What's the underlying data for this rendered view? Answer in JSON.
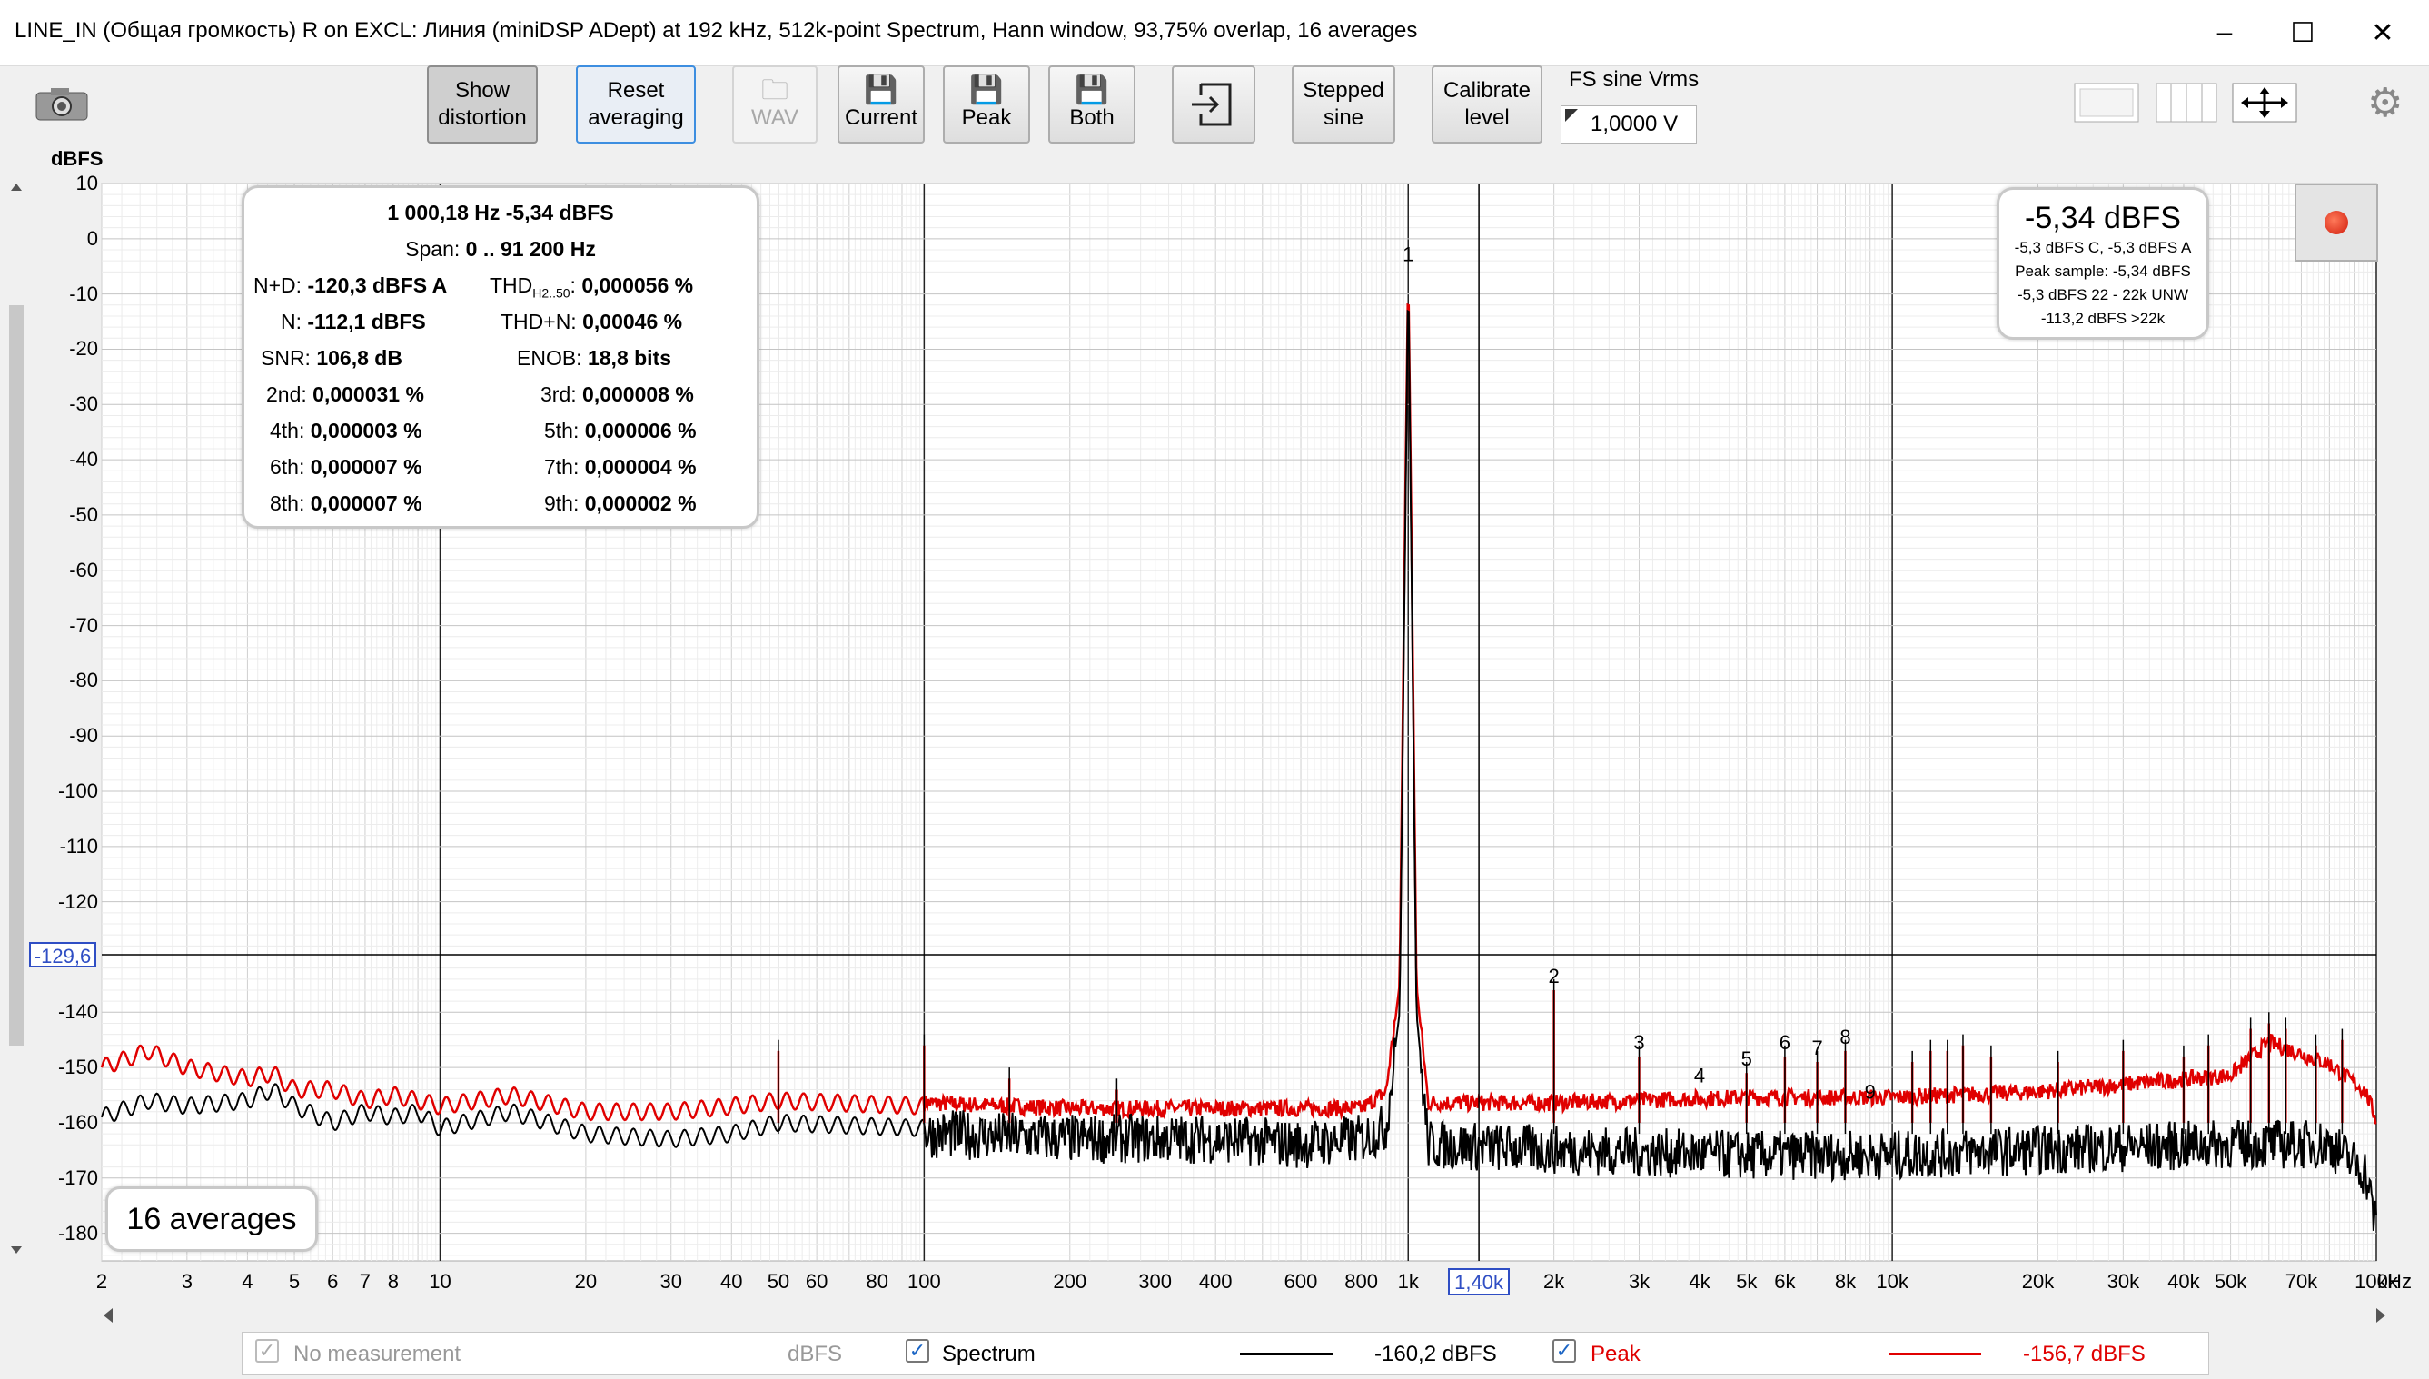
{
  "window": {
    "title": "LINE_IN (Общая громкость) R on EXCL: Линия (miniDSP ADept) at 192 kHz, 512k-point Spectrum, Hann window, 93,75% overlap, 16 averages",
    "minimize": "–",
    "maximize": "☐",
    "close": "✕"
  },
  "toolbar": {
    "show_distortion": [
      "Show",
      "distortion"
    ],
    "reset_averaging": [
      "Reset",
      "averaging"
    ],
    "wav": "WAV",
    "current": "Current",
    "peak": "Peak",
    "both": "Both",
    "stepped_sine": [
      "Stepped",
      "sine"
    ],
    "calibrate_level": [
      "Calibrate",
      "level"
    ],
    "fs_label": "FS sine Vrms",
    "fs_value": "1,0000 V"
  },
  "plot": {
    "y_unit": "dBFS",
    "cursor_y": "-129,6",
    "cursor_x": "1,40k",
    "x_unit": "kHz"
  },
  "measurement": {
    "header": "1 000,18 Hz  -5,34 dBFS",
    "span_label": "Span:",
    "span_value": "0 .. 91 200 Hz",
    "nd_label": "N+D:",
    "nd_value": "-120,3 dBFS A",
    "thd_label": "THD",
    "thd_sub": "H2..50",
    "thd_colon": ":",
    "thd_value": "0,000056 %",
    "n_label": "N:",
    "n_value": "-112,1 dBFS",
    "thdn_label": "THD+N:",
    "thdn_value": "0,00046 %",
    "snr_label": "SNR:",
    "snr_value": "106,8 dB",
    "enob_label": "ENOB:",
    "enob_value": "18,8 bits",
    "h2_label": "2nd:",
    "h2_value": "0,000031 %",
    "h3_label": "3rd:",
    "h3_value": "0,000008 %",
    "h4_label": "4th:",
    "h4_value": "0,000003 %",
    "h5_label": "5th:",
    "h5_value": "0,000006 %",
    "h6_label": "6th:",
    "h6_value": "0,000007 %",
    "h7_label": "7th:",
    "h7_value": "0,000004 %",
    "h8_label": "8th:",
    "h8_value": "0,000007 %",
    "h9_label": "9th:",
    "h9_value": "0,000002 %"
  },
  "level_box": {
    "main": "-5,34 dBFS",
    "line1": "-5,3 dBFS C, -5,3 dBFS A",
    "line2": "Peak sample: -5,34 dBFS",
    "line3": "-5,3 dBFS 22 - 22k UNW",
    "line4": "-113,2 dBFS >22k"
  },
  "averages_label": "16 averages",
  "legend": {
    "no_measurement": "No measurement",
    "no_measurement_unit": "dBFS",
    "spectrum": "Spectrum",
    "spectrum_value": "-160,2 dBFS",
    "peak": "Peak",
    "peak_value": "-156,7 dBFS",
    "spectrum_color": "#000000",
    "peak_color": "#e00000"
  },
  "chart_data": {
    "type": "line",
    "xscale": "log",
    "xlim": [
      2,
      100000
    ],
    "ylim": [
      -185,
      10
    ],
    "xticks": [
      {
        "v": 2,
        "label": "2"
      },
      {
        "v": 3,
        "label": "3"
      },
      {
        "v": 4,
        "label": "4"
      },
      {
        "v": 5,
        "label": "5"
      },
      {
        "v": 6,
        "label": "6"
      },
      {
        "v": 7,
        "label": "7"
      },
      {
        "v": 8,
        "label": "8"
      },
      {
        "v": 10,
        "label": "10"
      },
      {
        "v": 20,
        "label": "20"
      },
      {
        "v": 30,
        "label": "30"
      },
      {
        "v": 40,
        "label": "40"
      },
      {
        "v": 50,
        "label": "50"
      },
      {
        "v": 60,
        "label": "60"
      },
      {
        "v": 80,
        "label": "80"
      },
      {
        "v": 100,
        "label": "100"
      },
      {
        "v": 200,
        "label": "200"
      },
      {
        "v": 300,
        "label": "300"
      },
      {
        "v": 400,
        "label": "400"
      },
      {
        "v": 600,
        "label": "600"
      },
      {
        "v": 800,
        "label": "800"
      },
      {
        "v": 1000,
        "label": "1k"
      },
      {
        "v": 2000,
        "label": "2k"
      },
      {
        "v": 3000,
        "label": "3k"
      },
      {
        "v": 4000,
        "label": "4k"
      },
      {
        "v": 5000,
        "label": "5k"
      },
      {
        "v": 6000,
        "label": "6k"
      },
      {
        "v": 8000,
        "label": "8k"
      },
      {
        "v": 10000,
        "label": "10k"
      },
      {
        "v": 20000,
        "label": "20k"
      },
      {
        "v": 30000,
        "label": "30k"
      },
      {
        "v": 40000,
        "label": "40k"
      },
      {
        "v": 50000,
        "label": "50k"
      },
      {
        "v": 70000,
        "label": "70k"
      },
      {
        "v": 100000,
        "label": "100k"
      }
    ],
    "yticks": [
      10,
      0,
      -10,
      -20,
      -30,
      -40,
      -50,
      -60,
      -70,
      -80,
      -90,
      -100,
      -110,
      -120,
      -140,
      -150,
      -160,
      -170,
      -180
    ],
    "ytick_labels": [
      "10",
      "0",
      "-10",
      "-20",
      "-30",
      "-40",
      "-50",
      "-60",
      "-70",
      "-80",
      "-90",
      "-100",
      "-110",
      "-120",
      "-140",
      "-150",
      "-160",
      "-170",
      "-180"
    ],
    "cursor": {
      "x": 1400,
      "y": -129.6
    },
    "harmonic_markers": [
      {
        "label": "1",
        "x": 1000,
        "y": -5.34
      },
      {
        "label": "2",
        "x": 2000,
        "y": -136
      },
      {
        "label": "3",
        "x": 3000,
        "y": -148
      },
      {
        "label": "4",
        "x": 4000,
        "y": -154
      },
      {
        "label": "5",
        "x": 5000,
        "y": -151
      },
      {
        "label": "6",
        "x": 6000,
        "y": -148
      },
      {
        "label": "7",
        "x": 7000,
        "y": -149
      },
      {
        "label": "8",
        "x": 8000,
        "y": -147
      },
      {
        "label": "9",
        "x": 9000,
        "y": -157
      }
    ],
    "series": [
      {
        "name": "Spectrum",
        "color": "#000000",
        "points": [
          [
            2,
            -159
          ],
          [
            2.5,
            -156
          ],
          [
            3,
            -157
          ],
          [
            4,
            -156
          ],
          [
            4.5,
            -154
          ],
          [
            5,
            -157
          ],
          [
            6,
            -160
          ],
          [
            7,
            -158
          ],
          [
            8,
            -159
          ],
          [
            9,
            -158
          ],
          [
            10,
            -161
          ],
          [
            14,
            -158
          ],
          [
            20,
            -162
          ],
          [
            30,
            -163
          ],
          [
            40,
            -162
          ],
          [
            50,
            -160
          ],
          [
            100,
            -161
          ],
          [
            200,
            -162
          ],
          [
            400,
            -162
          ],
          [
            600,
            -163
          ],
          [
            800,
            -162
          ],
          [
            900,
            -160
          ],
          [
            960,
            -140
          ],
          [
            990,
            -40
          ],
          [
            1000,
            -5.34
          ],
          [
            1010,
            -40
          ],
          [
            1040,
            -140
          ],
          [
            1100,
            -163
          ],
          [
            2000,
            -164
          ],
          [
            5000,
            -165
          ],
          [
            10000,
            -165
          ],
          [
            20000,
            -164
          ],
          [
            50000,
            -163
          ],
          [
            80000,
            -163
          ],
          [
            95000,
            -168
          ],
          [
            100000,
            -178
          ]
        ]
      },
      {
        "name": "Peak",
        "color": "#e00000",
        "points": [
          [
            2,
            -150
          ],
          [
            2.5,
            -147
          ],
          [
            3,
            -150
          ],
          [
            4,
            -152
          ],
          [
            4.5,
            -151
          ],
          [
            5,
            -154
          ],
          [
            6,
            -154
          ],
          [
            7,
            -156
          ],
          [
            8,
            -155
          ],
          [
            9,
            -156
          ],
          [
            10,
            -157
          ],
          [
            14,
            -155
          ],
          [
            20,
            -158
          ],
          [
            30,
            -158
          ],
          [
            40,
            -157
          ],
          [
            50,
            -156
          ],
          [
            100,
            -157
          ],
          [
            200,
            -158
          ],
          [
            400,
            -158
          ],
          [
            600,
            -158
          ],
          [
            800,
            -158
          ],
          [
            900,
            -155
          ],
          [
            960,
            -135
          ],
          [
            990,
            -35
          ],
          [
            1000,
            -5.34
          ],
          [
            1010,
            -35
          ],
          [
            1040,
            -135
          ],
          [
            1100,
            -157
          ],
          [
            2000,
            -157
          ],
          [
            5000,
            -156
          ],
          [
            10000,
            -156
          ],
          [
            20000,
            -155
          ],
          [
            50000,
            -152
          ],
          [
            60000,
            -146
          ],
          [
            80000,
            -150
          ],
          [
            95000,
            -155
          ],
          [
            100000,
            -160
          ]
        ]
      }
    ],
    "spurs": [
      {
        "x": 50,
        "y": -147
      },
      {
        "x": 100,
        "y": -146
      },
      {
        "x": 150,
        "y": -152
      },
      {
        "x": 250,
        "y": -154
      },
      {
        "x": 2000,
        "y": -136
      },
      {
        "x": 3000,
        "y": -148
      },
      {
        "x": 5000,
        "y": -151
      },
      {
        "x": 6000,
        "y": -148
      },
      {
        "x": 7000,
        "y": -149
      },
      {
        "x": 8000,
        "y": -147
      },
      {
        "x": 11000,
        "y": -149
      },
      {
        "x": 12000,
        "y": -147
      },
      {
        "x": 13000,
        "y": -147
      },
      {
        "x": 14000,
        "y": -146
      },
      {
        "x": 16000,
        "y": -148
      },
      {
        "x": 22000,
        "y": -149
      },
      {
        "x": 30000,
        "y": -147
      },
      {
        "x": 40000,
        "y": -148
      },
      {
        "x": 45000,
        "y": -146
      },
      {
        "x": 55000,
        "y": -143
      },
      {
        "x": 60000,
        "y": -142
      },
      {
        "x": 65000,
        "y": -143
      },
      {
        "x": 75000,
        "y": -146
      },
      {
        "x": 85000,
        "y": -145
      }
    ]
  }
}
